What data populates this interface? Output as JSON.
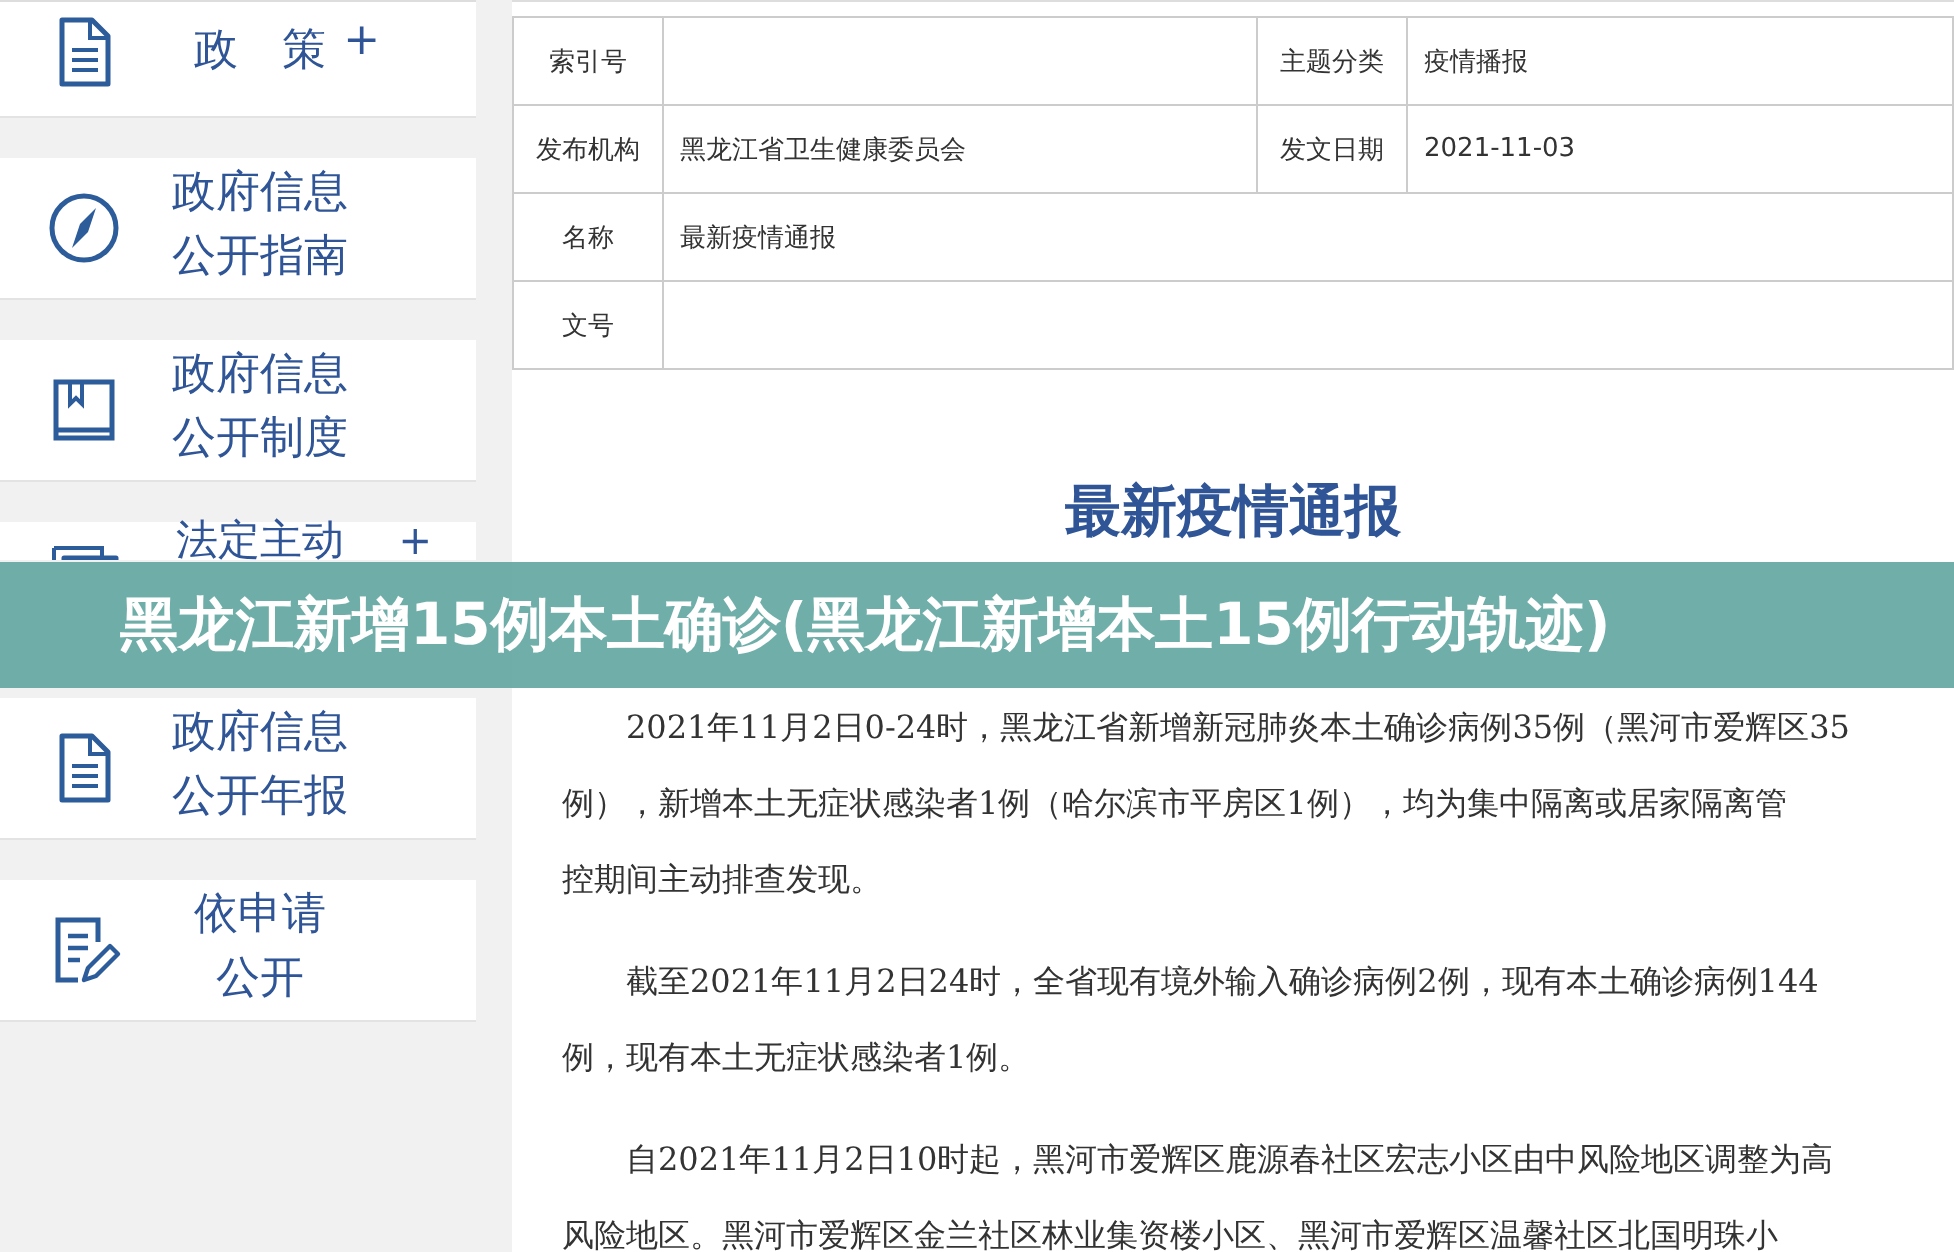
{
  "sidebar": {
    "items": [
      {
        "lines": [
          "政　策"
        ],
        "toggle": "+"
      },
      {
        "lines": [
          "政府信息",
          "公开指南"
        ]
      },
      {
        "lines": [
          "政府信息",
          "公开制度"
        ]
      },
      {
        "lines": [
          "法定主动"
        ],
        "toggle": "+"
      },
      {
        "lines": [
          "政府信息",
          "公开年报"
        ]
      },
      {
        "lines": [
          "依申请",
          "公开"
        ]
      }
    ]
  },
  "info_table": {
    "rows": [
      {
        "cells": [
          {
            "label": "索引号"
          },
          {
            "label": "主题分类",
            "value": "疫情播报"
          }
        ]
      },
      {
        "cells": [
          {
            "label": "发布机构",
            "value": "黑龙江省卫生健康委员会"
          },
          {
            "label": "发文日期",
            "value": "2021-11-03"
          }
        ]
      },
      {
        "cells": [
          {
            "label": "名称",
            "value": "最新疫情通报"
          }
        ]
      },
      {
        "cells": [
          {
            "label": "文号"
          }
        ]
      }
    ]
  },
  "article": {
    "title": "最新疫情通报",
    "paragraphs": [
      [
        "2021年11月2日0-24时，黑龙江省新增新冠肺炎本土确诊病例35例（黑河市爱辉区35",
        "例），新增本土无症状感染者1例（哈尔滨市平房区1例），均为集中隔离或居家隔离管",
        "控期间主动排查发现。"
      ],
      [
        "截至2021年11月2日24时，全省现有境外输入确诊病例2例，现有本土确诊病例144",
        "例，现有本土无症状感染者1例。"
      ],
      [
        "自2021年11月2日10时起，黑河市爱辉区鹿源春社区宏志小区由中风险地区调整为高",
        "风险地区。黑河市爱辉区金兰社区林业集资楼小区、黑河市爱辉区温馨社区北国明珠小"
      ]
    ]
  },
  "banner": {
    "headline": "黑龙江新增15例本土确诊(黑龙江新增本土15例行动轨迹)"
  }
}
